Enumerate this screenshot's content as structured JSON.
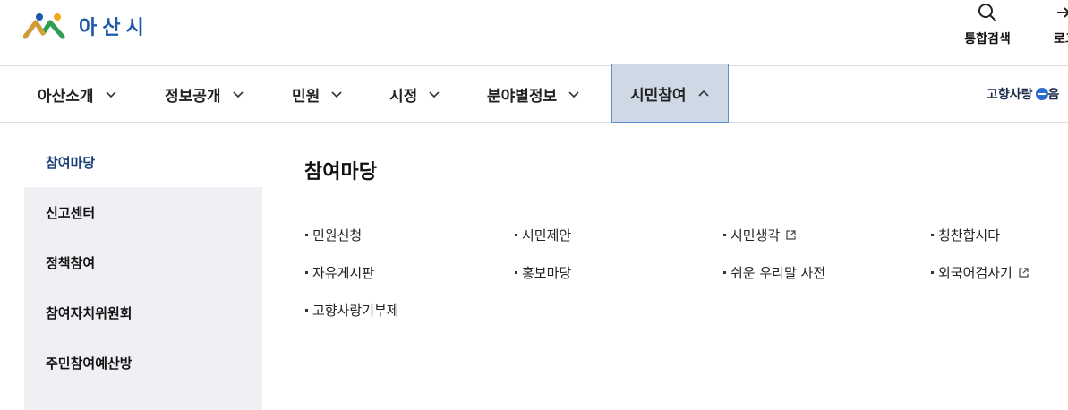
{
  "header": {
    "logo_text": "아산시",
    "search_label": "통합검색",
    "login_label": "로그"
  },
  "gnb": {
    "items": [
      {
        "label": "아산소개",
        "expanded": false
      },
      {
        "label": "정보공개",
        "expanded": false
      },
      {
        "label": "민원",
        "expanded": false
      },
      {
        "label": "시정",
        "expanded": false
      },
      {
        "label": "분야별정보",
        "expanded": false
      },
      {
        "label": "시민참여",
        "expanded": true
      }
    ],
    "extra_label": "고향사랑",
    "extra_suffix": "음"
  },
  "side_menu": {
    "items": [
      {
        "label": "참여마당",
        "active": true
      },
      {
        "label": "신고센터",
        "active": false
      },
      {
        "label": "정책참여",
        "active": false
      },
      {
        "label": "참여자치위원회",
        "active": false
      },
      {
        "label": "주민참여예산방",
        "active": false
      }
    ]
  },
  "content": {
    "title": "참여마당",
    "links": [
      {
        "label": "민원신청",
        "external": false
      },
      {
        "label": "시민제안",
        "external": false
      },
      {
        "label": "시민생각",
        "external": true
      },
      {
        "label": "칭찬합시다",
        "external": false
      },
      {
        "label": "자유게시판",
        "external": false
      },
      {
        "label": "홍보마당",
        "external": false
      },
      {
        "label": "쉬운 우리말 사전",
        "external": false
      },
      {
        "label": "외국어검사기",
        "external": true
      },
      {
        "label": "고향사랑기부제",
        "external": false
      }
    ]
  },
  "colors": {
    "brand_blue": "#1e5aa8",
    "active_tab_bg": "#cfd9e6",
    "active_tab_border": "#5b8fd6",
    "side_bg": "#eef0f3",
    "side_active_text": "#1b3f7a"
  }
}
